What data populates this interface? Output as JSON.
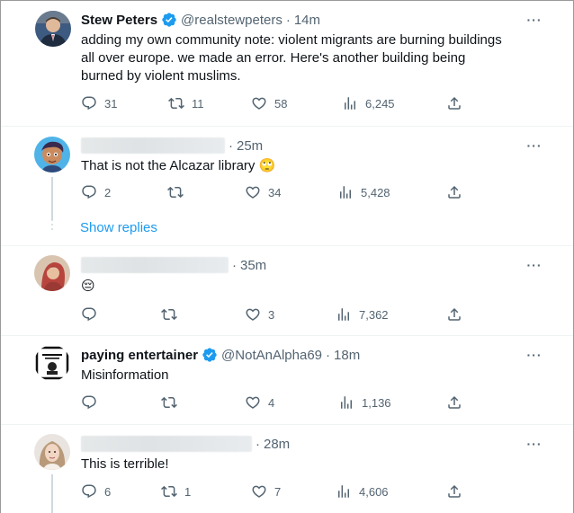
{
  "tweets": [
    {
      "name": "Stew Peters",
      "handle": "@realstewpeters",
      "time": "14m",
      "text": "adding my own community note: violent migrants are burning buildings all over europe. we made an error. Here's another building being burned by violent muslims.",
      "replies": "31",
      "retweets": "11",
      "likes": "58",
      "views": "6,245",
      "verified": true
    },
    {
      "name": "",
      "handle": "",
      "time": "25m",
      "text": "That is not the Alcazar library 🙄",
      "replies": "2",
      "retweets": "",
      "likes": "34",
      "views": "5,428"
    },
    {
      "name": "",
      "handle": "",
      "time": "35m",
      "text": "😔",
      "replies": "",
      "retweets": "",
      "likes": "3",
      "views": "7,362"
    },
    {
      "name": "paying entertainer",
      "handle": "@NotAnAlpha69",
      "time": "18m",
      "text": "Misinformation",
      "replies": "",
      "retweets": "",
      "likes": "4",
      "views": "1,136",
      "verified": true
    },
    {
      "name": "",
      "handle": "",
      "time": "28m",
      "text": "This is terrible!",
      "replies": "6",
      "retweets": "1",
      "likes": "7",
      "views": "4,606"
    }
  ],
  "show_replies": "Show replies",
  "separator": "·",
  "colors": {
    "accent": "#1d9bf0",
    "muted": "#536471",
    "text": "#0f1419",
    "divider": "#eff3f4"
  },
  "icons": [
    "reply-icon",
    "retweet-icon",
    "like-icon",
    "views-icon",
    "share-icon",
    "more-icon",
    "verified-icon"
  ]
}
